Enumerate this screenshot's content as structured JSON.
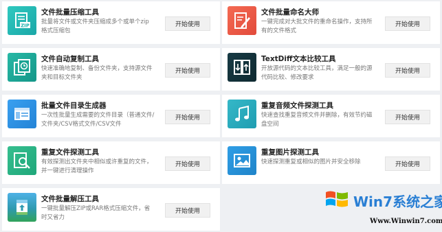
{
  "button_label": "开始使用",
  "tools": [
    {
      "title": "文件批量压缩工具",
      "desc": "批量将文件或文件夹压缩成多个或单个zip格式压缩包",
      "icon": "zip-file-icon",
      "color": "#1fb3b0"
    },
    {
      "title": "文件批量命名大师",
      "desc": "一键完成对大批文件的重命名操作，支持所有的文件格式",
      "icon": "rename-file-icon",
      "color": "#e9553f"
    },
    {
      "title": "文件自动复制工具",
      "desc": "快速准确地复制、备份文件夹，支持源文件夹和目标文件夹",
      "icon": "copy-clock-icon",
      "color": "#19a393"
    },
    {
      "title": "TextDiff文本比较工具",
      "desc": "开放源代码的文本比较工具，满足一般的源代码比较、修改要求",
      "icon": "text-compare-icon",
      "color": "#133239"
    },
    {
      "title": "批量文件目录生成器",
      "desc": "一次性批量生成需要的文件目录（普通文件/文件夹/CSV格式文件/CSV文件",
      "icon": "directory-window-icon",
      "color": "#2a8ee0"
    },
    {
      "title": "重复音频文件探测工具",
      "desc": "快速查找重复音频文件并删除，有效节约磁盘空间",
      "icon": "music-note-icon",
      "color": "#26a8bb"
    },
    {
      "title": "重复文件探测工具",
      "desc": "有效探测出文件夹中相似或许重复的文件，并一键进行清理操作",
      "icon": "search-file-icon",
      "color": "#27b083"
    },
    {
      "title": "重复图片探测工具",
      "desc": "快速探测重复或相似的图片并安全移除",
      "icon": "image-file-icon",
      "color": "#2590d5"
    },
    {
      "title": "文件批量解压工具",
      "desc": "一键批量解压ZIP或RAR格式压缩文件，省时又省力",
      "icon": "unzip-archive-icon",
      "color": "#2e9ab0"
    }
  ],
  "watermark": {
    "brand": "Win7系统之家",
    "url": "Www.Winwin7.com"
  }
}
